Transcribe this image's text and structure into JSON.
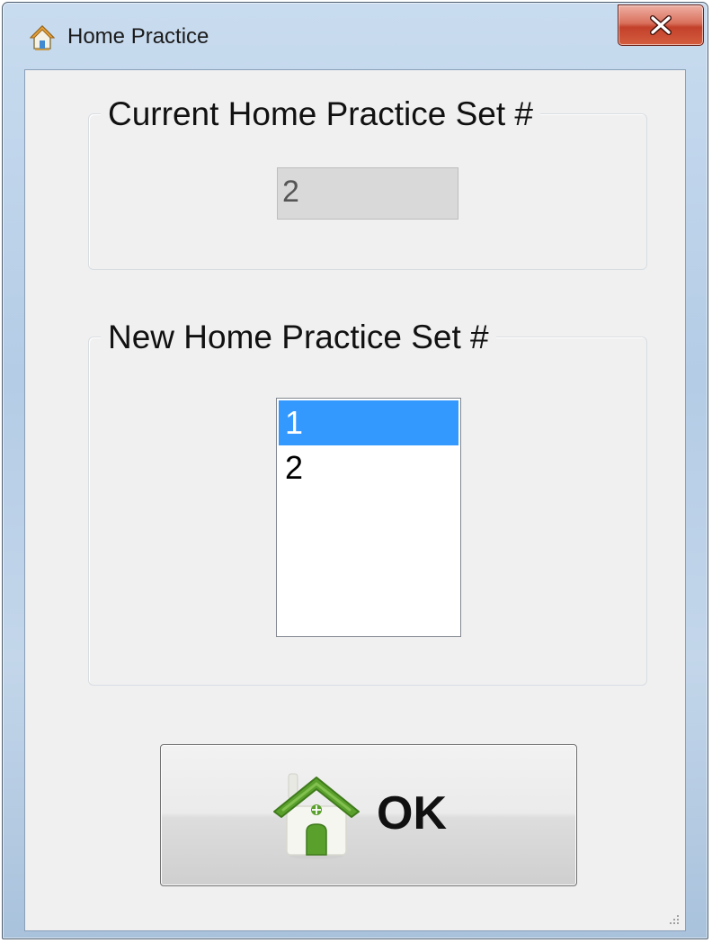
{
  "window": {
    "title": "Home Practice",
    "icon": "house-icon",
    "close_label": "×"
  },
  "current_group": {
    "label": "Current Home Practice Set #",
    "value": "2"
  },
  "new_group": {
    "label": "New Home Practice Set #",
    "options": [
      "1",
      "2"
    ],
    "selected": "1"
  },
  "ok_button": {
    "label": "OK",
    "icon": "house-icon"
  },
  "colors": {
    "selection": "#3399ff",
    "close_button": "#c3402a",
    "house_roof": "#5aa02c"
  }
}
